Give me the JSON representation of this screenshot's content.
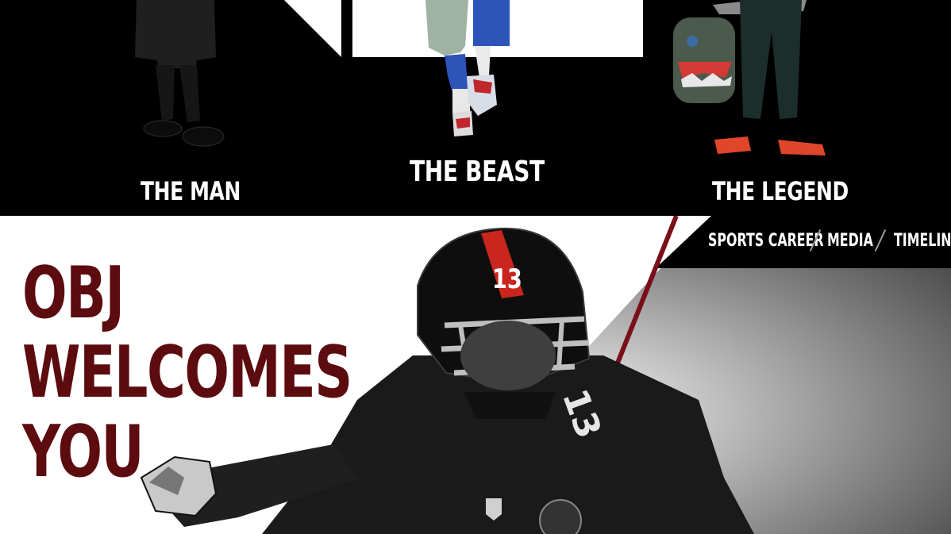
{
  "personas": [
    {
      "label": "THE MAN"
    },
    {
      "label": "THE BEAST"
    },
    {
      "label": "THE LEGEND"
    }
  ],
  "nav": {
    "items": [
      "SPORTS CAREER",
      "MEDIA",
      "TIMELINE"
    ]
  },
  "hero": {
    "headline": [
      "OBJ",
      "WELCOMES",
      "YOU"
    ],
    "helmet_number": "13",
    "jersey_number": "13"
  },
  "colors": {
    "top_background": "#000000",
    "headline": "#5c0b0f",
    "accent_line": "#7a0f19",
    "helmet_stripe": "#c8261e",
    "nav_text": "#ffffff"
  }
}
